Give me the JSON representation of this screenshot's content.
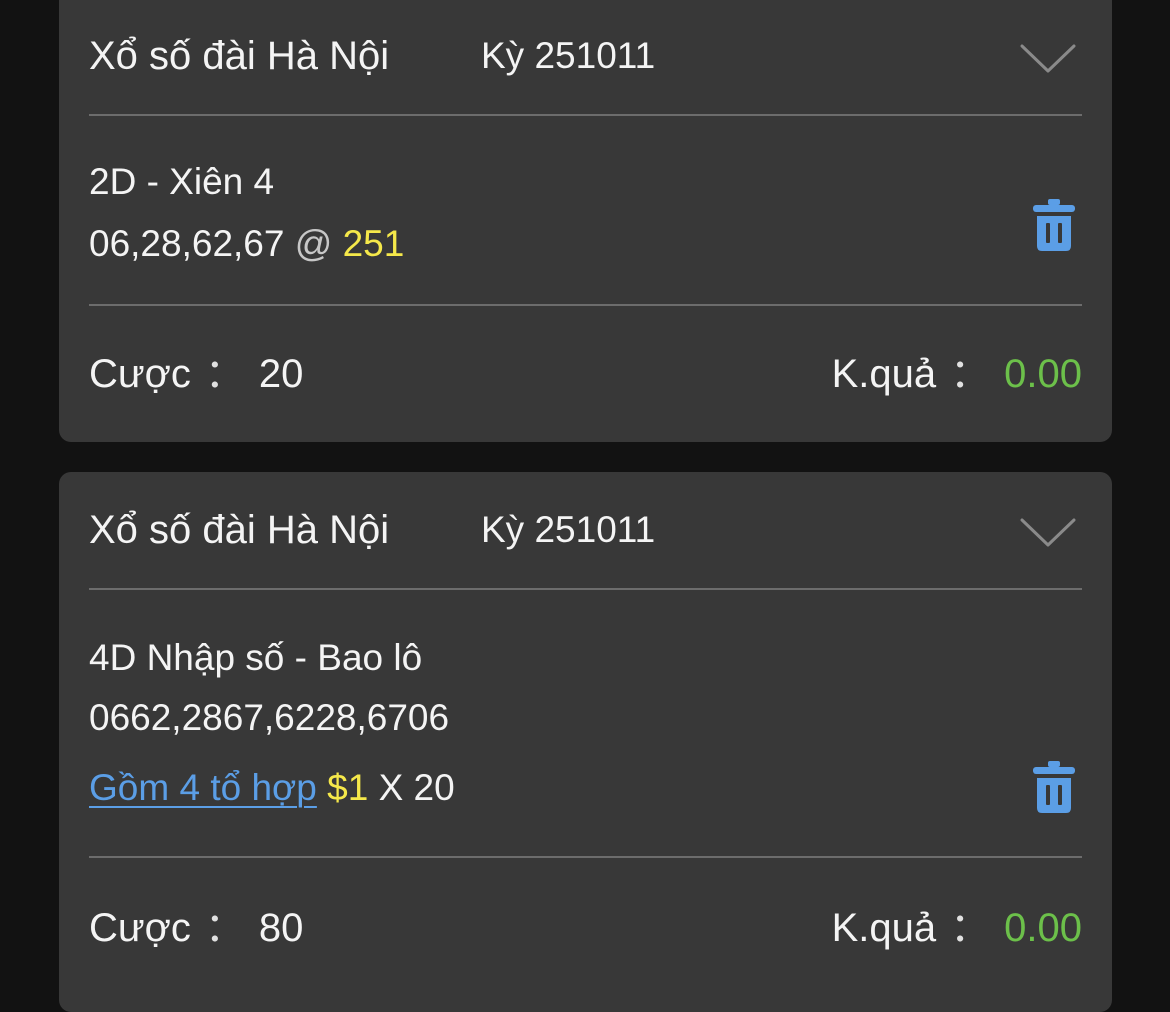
{
  "colors": {
    "background": "#121212",
    "card": "#383838",
    "divider": "#6c6c6c",
    "text": "#f4f4f4",
    "highlight_yellow": "#f5e84a",
    "result_green": "#6cc04a",
    "link_blue": "#5b9ee6",
    "trash_blue": "#5b9ee6"
  },
  "icons": {
    "expand": "chevron-down-icon",
    "delete": "trash-icon"
  },
  "bets": [
    {
      "lottery": "Xổ số đài Hà Nội",
      "period": "Kỳ 251011",
      "type": "2D - Xiên 4",
      "numbers": "06,28,62,67",
      "at": "@",
      "odds": "251",
      "stake_label": "Cược",
      "separator": "：",
      "stake": "20",
      "result_label": "K.quả",
      "result": "0.00"
    },
    {
      "lottery": "Xổ số đài Hà Nội",
      "period": "Kỳ 251011",
      "type": "4D Nhập số - Bao lô",
      "numbers": "0662,2867,6228,6706",
      "combo_link": "Gồm 4 tổ hợp",
      "unit_price": "$1",
      "multiplier": "X 20",
      "stake_label": "Cược",
      "separator": "：",
      "stake": "80",
      "result_label": "K.quả",
      "result": "0.00"
    }
  ]
}
